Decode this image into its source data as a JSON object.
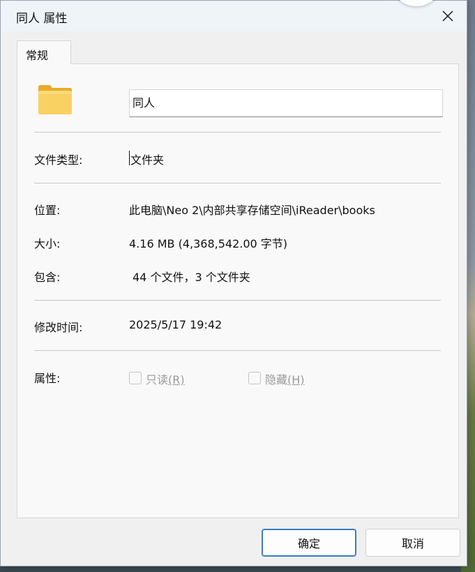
{
  "window": {
    "title": "同人 属性"
  },
  "tabs": [
    {
      "label": "常规"
    }
  ],
  "general": {
    "folder_name": "同人",
    "fields": {
      "type": {
        "label": "文件类型:",
        "value": "文件夹"
      },
      "location": {
        "label": "位置:",
        "value": "此电脑\\Neo 2\\内部共享存储空间\\iReader\\books"
      },
      "size": {
        "label": "大小:",
        "value": "4.16 MB (4,368,542.00 字节)"
      },
      "contains": {
        "label": "包含:",
        "value": "44 个文件，3 个文件夹"
      },
      "modified": {
        "label": "修改时间:",
        "value": "2025/5/17 19:42"
      },
      "attributes": {
        "label": "属性:"
      }
    },
    "attributes": {
      "readonly": {
        "label": "只读",
        "hotkey": "(R)",
        "checked": false,
        "enabled": false
      },
      "hidden": {
        "label": "隐藏",
        "hotkey": "(H)",
        "checked": false,
        "enabled": false
      }
    }
  },
  "buttons": {
    "ok": "确定",
    "cancel": "取消"
  },
  "icons": {
    "close": "close-icon",
    "folder": "folder-icon"
  },
  "colors": {
    "accent": "#3a7cc2",
    "folder": "#f8c84a"
  }
}
